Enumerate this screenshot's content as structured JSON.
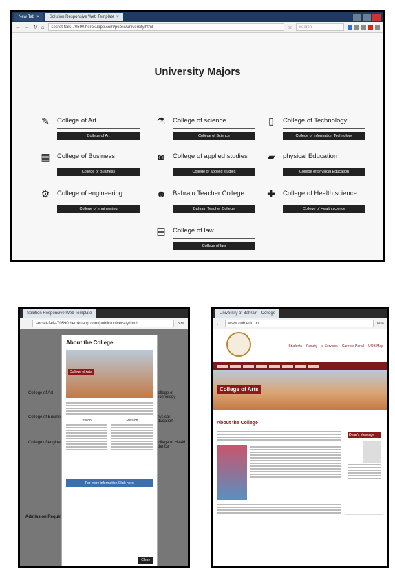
{
  "top": {
    "tabs": [
      {
        "label": "New Tab"
      },
      {
        "label": "Solution Responsive Web Template"
      }
    ],
    "url": "secret-fails-70590.herokuapp.com/public/university.html",
    "search_placeholder": "Search",
    "heading": "University Majors",
    "majors": [
      {
        "name": "College of Art",
        "button": "College of Art",
        "icon": "pencil-icon"
      },
      {
        "name": "College of science",
        "button": "College of Science",
        "icon": "flask-icon"
      },
      {
        "name": "College of Technology",
        "button": "College of Information Technology",
        "icon": "mobile-icon"
      },
      {
        "name": "College of Business",
        "button": "College of Business",
        "icon": "calculator-icon"
      },
      {
        "name": "College of applied studies",
        "button": "College of applied studies",
        "icon": "camera-icon"
      },
      {
        "name": "physical Education",
        "button": "College of physical Education",
        "icon": "book-icon"
      },
      {
        "name": "College of engineering",
        "button": "College of engineering",
        "icon": "gear-icon"
      },
      {
        "name": "Bahrain Teacher College",
        "button": "Bahrain Teacher College",
        "icon": "user-icon"
      },
      {
        "name": "College of Health science",
        "button": "College of Health science",
        "icon": "medkit-icon"
      },
      {
        "name": "College of law",
        "button": "College of law",
        "icon": "building-icon"
      }
    ]
  },
  "left_shot": {
    "tab": "Solution Responsive Web Template",
    "url": "secret-fails-70590.herokuapp.com/public/university.html",
    "zoom": "80%",
    "modal_title": "About the College",
    "banner_label": "College of Arts",
    "col1_title": "Vision",
    "col2_title": "Mission",
    "link_button": "For more information Click here",
    "close_button": "Close",
    "side_heading": "Admission Requirements",
    "majors": [
      "College of Art",
      "College of Business",
      "College of engineering",
      "College of Technology",
      "physical Education",
      "College of Health science"
    ]
  },
  "right_shot": {
    "tab": "University of Bahrain - College",
    "url": "www.uob.edu.bh",
    "zoom": "80%",
    "banner_label": "College of Arts",
    "section_title": "About the College",
    "dean_title": "Dean's Message",
    "nav_links": [
      "Students",
      "Faculty",
      "e-Services",
      "Careers Portal",
      "UOB Map"
    ]
  }
}
